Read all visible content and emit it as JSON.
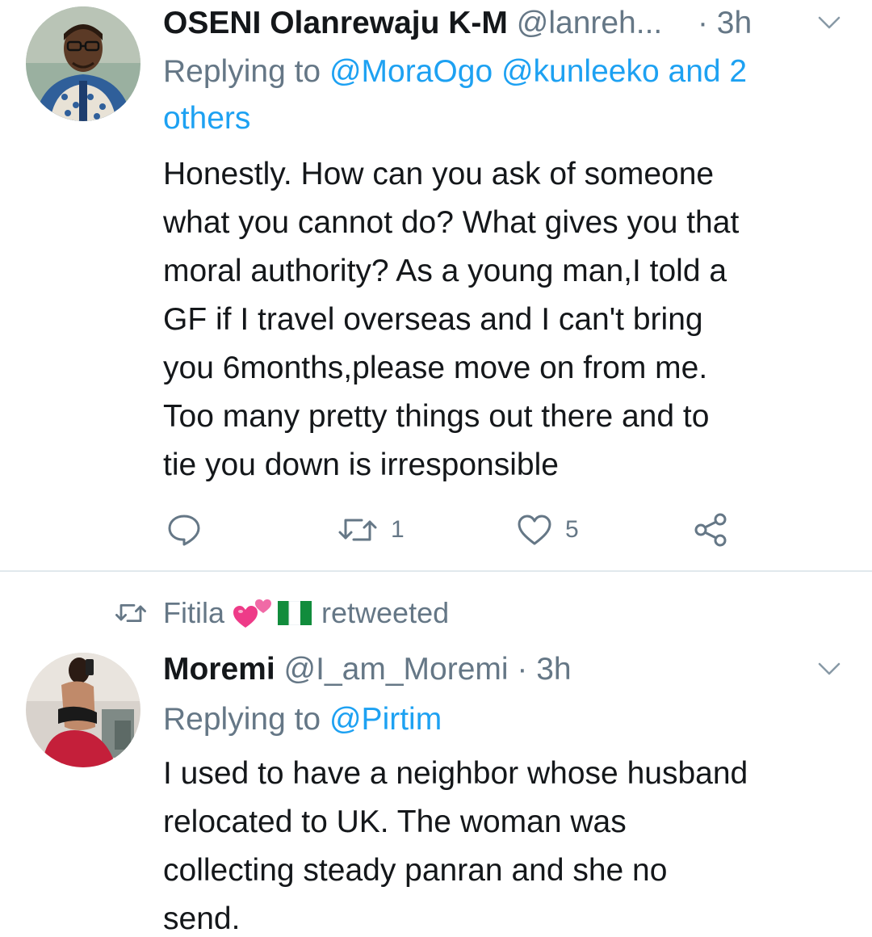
{
  "tweet1": {
    "display_name": "OSENI Olanrewaju K-M",
    "handle": "@lanreh...",
    "separator": "·",
    "time": "3h",
    "replying_prefix": "Replying to",
    "replying_mentions": "@MoraOgo @kunleeko and 2 others",
    "lines": [
      "Honestly.  How can you ask of someone",
      "what you cannot do? What gives you that",
      "moral authority? As a young man,I told a",
      "GF if I travel overseas and I can't bring",
      "you 6months,please move on from me.",
      "Too many pretty things out there and to",
      "tie you down is irresponsible"
    ],
    "retweet_count": "1",
    "like_count": "5",
    "icons": [
      "reply-icon",
      "retweet-icon",
      "like-icon",
      "share-icon",
      "chevron-down-icon"
    ]
  },
  "retweet_banner": {
    "retweeter_name": "Fitila",
    "emojis": [
      "two-hearts-emoji",
      "nigeria-flag-emoji"
    ],
    "label": "retweeted"
  },
  "tweet2": {
    "display_name": "Moremi",
    "handle": "@I_am_Moremi",
    "separator": "·",
    "time": "3h",
    "replying_prefix": "Replying to",
    "replying_mentions": "@Pirtim",
    "lines": [
      "I used to have a neighbor whose husband",
      "relocated to UK. The woman was",
      "collecting steady panran and she no",
      "send."
    ]
  },
  "colors": {
    "text": "#14171a",
    "secondary": "#657786",
    "link": "#1da1f2",
    "divider": "#e1e8ed"
  }
}
